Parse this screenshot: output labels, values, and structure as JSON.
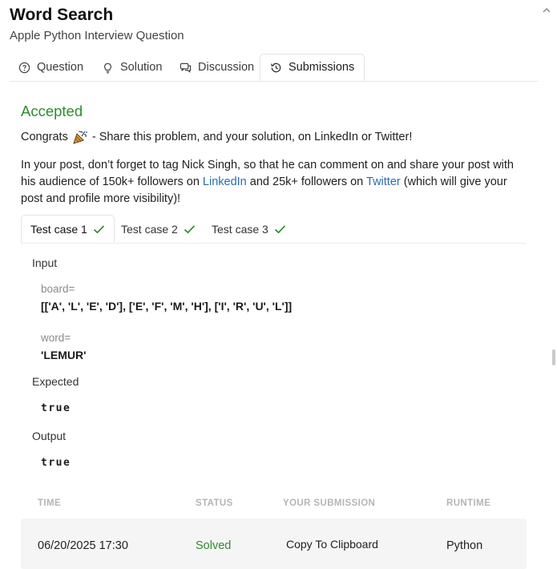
{
  "header": {
    "title": "Word Search",
    "subtitle": "Apple Python Interview Question"
  },
  "tabs": [
    {
      "label": "Question",
      "icon": "question-circle-icon"
    },
    {
      "label": "Solution",
      "icon": "lightbulb-icon"
    },
    {
      "label": "Discussion",
      "icon": "chat-icon"
    },
    {
      "label": "Submissions",
      "icon": "history-icon",
      "active": true
    }
  ],
  "result": {
    "status": "Accepted",
    "congrats_prefix": "Congrats",
    "congrats_suffix": "- Share this problem, and your solution, on LinkedIn or Twitter!",
    "post_text_1": "In your post, don’t forget to tag Nick Singh, so that he can comment on and share your post with his audience of 150k+ followers on ",
    "linkedin": "LinkedIn",
    "post_text_2": " and 25k+ followers on ",
    "twitter": "Twitter",
    "post_text_3": " (which will give your post and profile more visibility)!"
  },
  "test_cases": [
    {
      "label": "Test case 1",
      "active": true
    },
    {
      "label": "Test case 2"
    },
    {
      "label": "Test case 3"
    }
  ],
  "case_detail": {
    "input_label": "Input",
    "board_name": "board=",
    "board_value": "[['A', 'L', 'E', 'D'], ['E', 'F', 'M', 'H'], ['I', 'R', 'U', 'L']]",
    "word_name": "word=",
    "word_value": "'LEMUR'",
    "expected_label": "Expected",
    "expected_value": "true",
    "output_label": "Output",
    "output_value": "true"
  },
  "submissions": {
    "headers": {
      "time": "TIME",
      "status": "STATUS",
      "submission": "YOUR SUBMISSION",
      "runtime": "RUNTIME"
    },
    "rows": [
      {
        "time": "06/20/2025 17:30",
        "status": "Solved",
        "submission": "Copy To Clipboard",
        "runtime": "Python"
      }
    ]
  },
  "colors": {
    "accepted": "#2e8b2e",
    "link": "#2b6cb0",
    "check": "#2e8b2e",
    "solved": "#2e8b2e"
  }
}
